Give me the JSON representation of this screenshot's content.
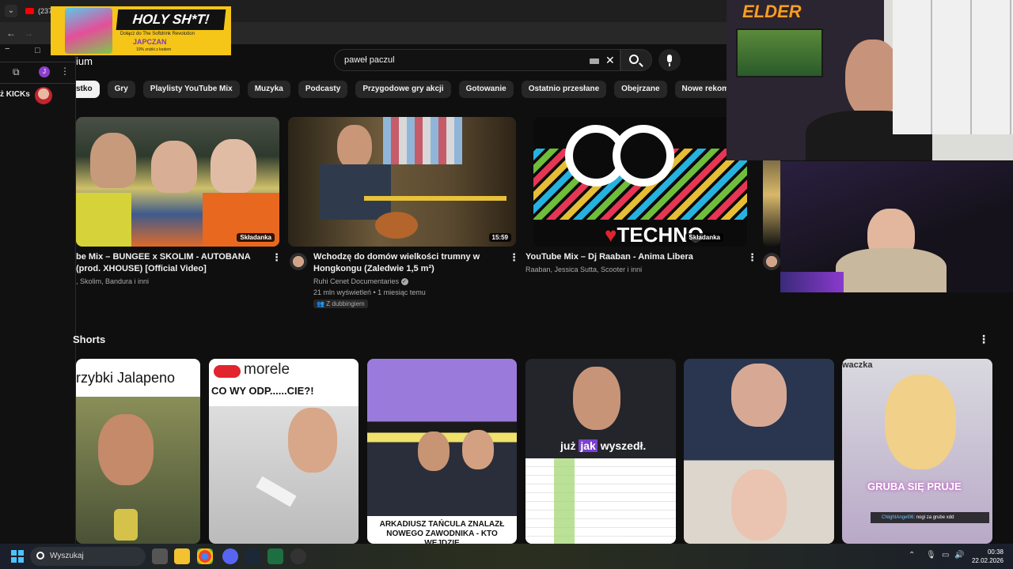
{
  "browser": {
    "tab_title": "(237) YouTub",
    "ext_label": "ż KICKs",
    "profile_letter": "J"
  },
  "ad": {
    "headline": "HOLY SH*T!",
    "sub": "Dołącz do The Softdrink Revolution",
    "brand": "JAPCZAN",
    "fine": "10% zniżki z kodem"
  },
  "header": {
    "logo_fragment": "ium",
    "search_value": "paweł paczul"
  },
  "chips": [
    "stko",
    "Gry",
    "Playlisty YouTube Mix",
    "Muzyka",
    "Podcasty",
    "Przygodowe gry akcji",
    "Gotowanie",
    "Ostatnio przesłane",
    "Obejrzane",
    "Nowe rekomendacje"
  ],
  "videos": [
    {
      "title": "be Mix – BUNGEE x SKOLIM - AUTOBANA (prod. XHOUSE) [Official Video]",
      "meta": ", Skolim, Bandura i inni",
      "badge": "Składanka"
    },
    {
      "title": "Wchodzę do domów wielkości trumny w Hongkongu (Zaledwie 1,5 m²)",
      "channel": "Ruhi Cenet Documentaries",
      "stats": "21 mln wyświetleń • 1 miesiąc temu",
      "dub": "Z dubbingiem",
      "badge": "15:59"
    },
    {
      "title": "YouTube Mix – Dj Raaban - Anima Libera",
      "meta": "Raaban, Jessica Sutta, Scooter i inni",
      "badge": "Składanka",
      "thumb_text": "TECHNO"
    }
  ],
  "shorts": {
    "title": "Shorts",
    "items": [
      {
        "caption": "rzybki Jalapeno"
      },
      {
        "brand": "morele",
        "caption": "CO WY ODP......CIE?!"
      },
      {
        "caption": "ARKADIUSZ TAŃCULA ZNALAZŁ NOWEGO ZAWODNIKA - KTO WEJDZIE"
      },
      {
        "caption_a": "już ",
        "caption_b": "jak",
        "caption_c": " wyszedł."
      },
      {},
      {
        "caption": "GRUBA SIĘ PRUJE",
        "chat_user": "CNightAngel06",
        "chat_msg": "nogi za grube xdd",
        "top_fragment": "waczka"
      }
    ]
  },
  "stream": {
    "overlay_name": "ELDER"
  },
  "taskbar": {
    "search_label": "Wyszukaj",
    "time": "00:38",
    "date": "22.02.2026"
  }
}
